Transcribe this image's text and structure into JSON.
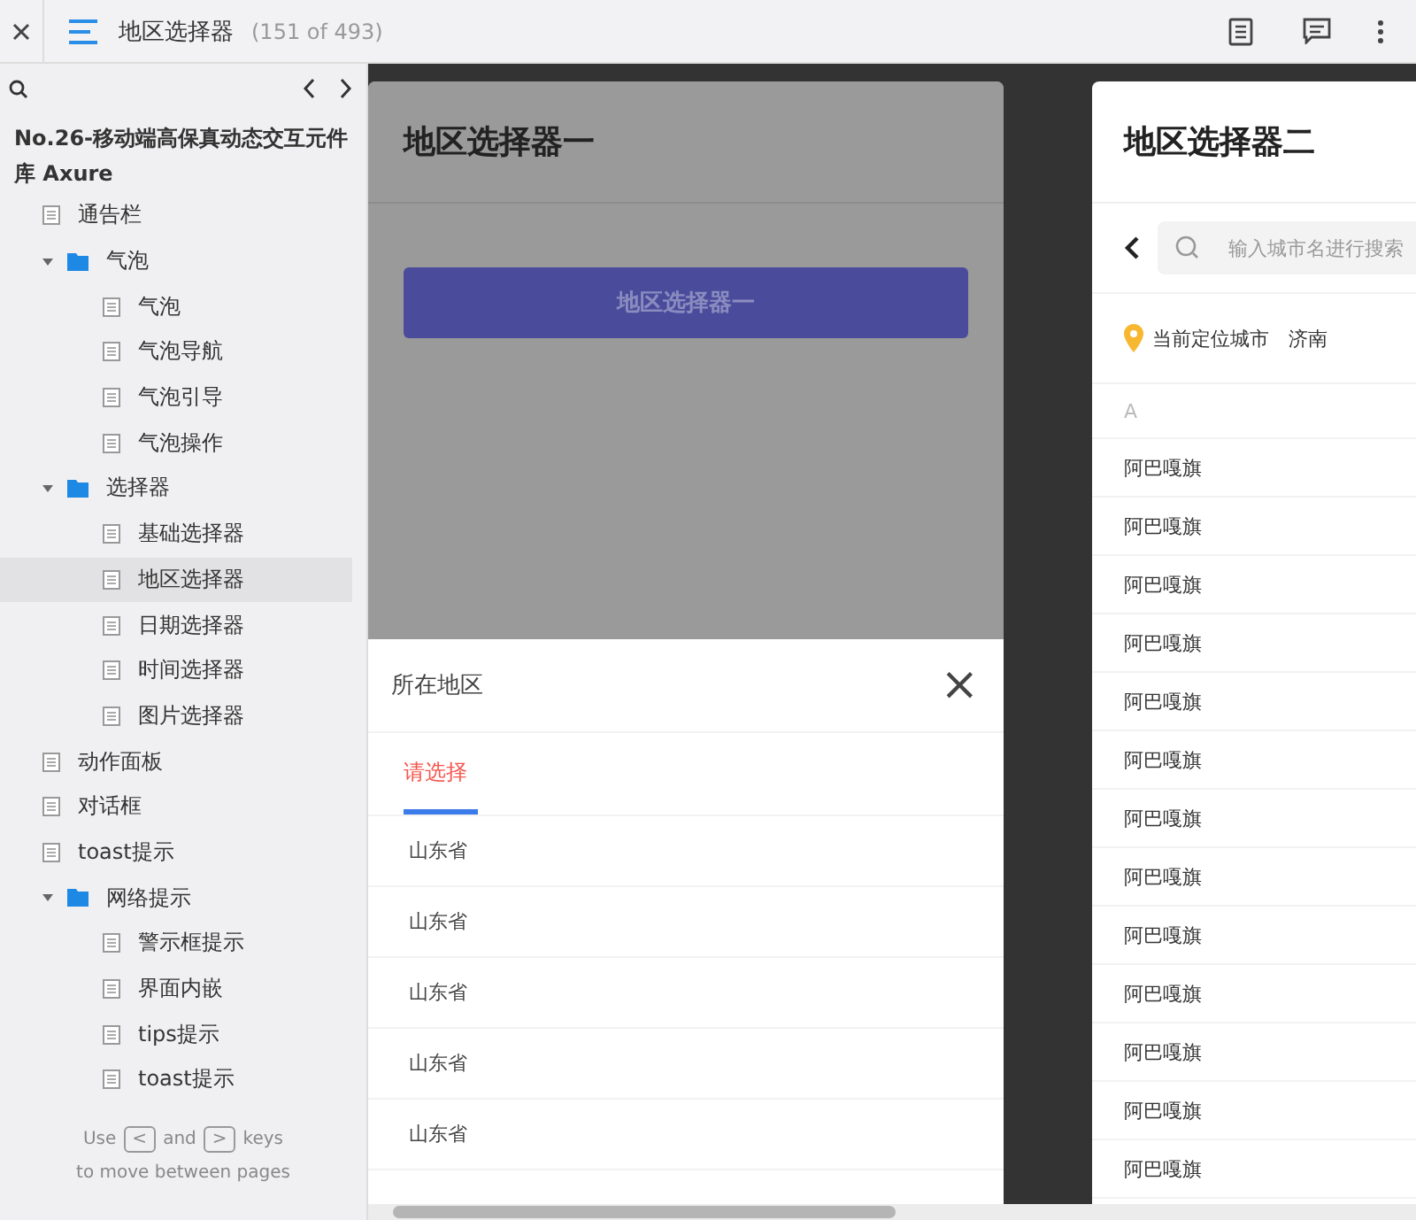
{
  "topbar": {
    "title": "地区选择器",
    "count": "(151 of 493)"
  },
  "sidebar": {
    "project": "No.26-移动端高保真动态交互元件库 Axure",
    "tree": [
      {
        "label": "通告栏",
        "kind": "page",
        "selected": false
      },
      {
        "label": "气泡",
        "kind": "folder",
        "expanded": true,
        "children": [
          {
            "label": "气泡",
            "kind": "page",
            "selected": false
          },
          {
            "label": "气泡导航",
            "kind": "page",
            "selected": false
          },
          {
            "label": "气泡引导",
            "kind": "page",
            "selected": false
          },
          {
            "label": "气泡操作",
            "kind": "page",
            "selected": false
          }
        ]
      },
      {
        "label": "选择器",
        "kind": "folder",
        "expanded": true,
        "children": [
          {
            "label": "基础选择器",
            "kind": "page",
            "selected": false
          },
          {
            "label": "地区选择器",
            "kind": "page",
            "selected": true
          },
          {
            "label": "日期选择器",
            "kind": "page",
            "selected": false
          },
          {
            "label": "时间选择器",
            "kind": "page",
            "selected": false
          },
          {
            "label": "图片选择器",
            "kind": "page",
            "selected": false
          }
        ]
      },
      {
        "label": "动作面板",
        "kind": "page",
        "selected": false
      },
      {
        "label": "对话框",
        "kind": "page",
        "selected": false
      },
      {
        "label": "toast提示",
        "kind": "page",
        "selected": false
      },
      {
        "label": "网络提示",
        "kind": "folder",
        "expanded": true,
        "children": [
          {
            "label": "警示框提示",
            "kind": "page",
            "selected": false
          },
          {
            "label": "界面内嵌",
            "kind": "page",
            "selected": false
          },
          {
            "label": "tips提示",
            "kind": "page",
            "selected": false
          },
          {
            "label": "toast提示",
            "kind": "page",
            "selected": false
          }
        ]
      }
    ],
    "hint": {
      "use": "Use",
      "prev_key": "<",
      "and": "and",
      "next_key": ">",
      "keys": "keys",
      "line2": "to move between pages"
    }
  },
  "panel_one": {
    "title": "地区选择器一",
    "button": "地区选择器一",
    "sheet": {
      "title": "所在地区",
      "close": "×",
      "tabs": [
        {
          "label": "请选择",
          "selected": true
        }
      ],
      "rows": [
        "山东省",
        "山东省",
        "山东省",
        "山东省",
        "山东省"
      ]
    }
  },
  "panel_two": {
    "title": "地区选择器二",
    "search": {
      "placeholder": "输入城市名进行搜索"
    },
    "location": {
      "label": "当前定位城市",
      "city": "济南"
    },
    "section": "A",
    "cities": [
      "阿巴嘎旗",
      "阿巴嘎旗",
      "阿巴嘎旗",
      "阿巴嘎旗",
      "阿巴嘎旗",
      "阿巴嘎旗",
      "阿巴嘎旗",
      "阿巴嘎旗",
      "阿巴嘎旗",
      "阿巴嘎旗",
      "阿巴嘎旗",
      "阿巴嘎旗",
      "阿巴嘎旗"
    ]
  }
}
